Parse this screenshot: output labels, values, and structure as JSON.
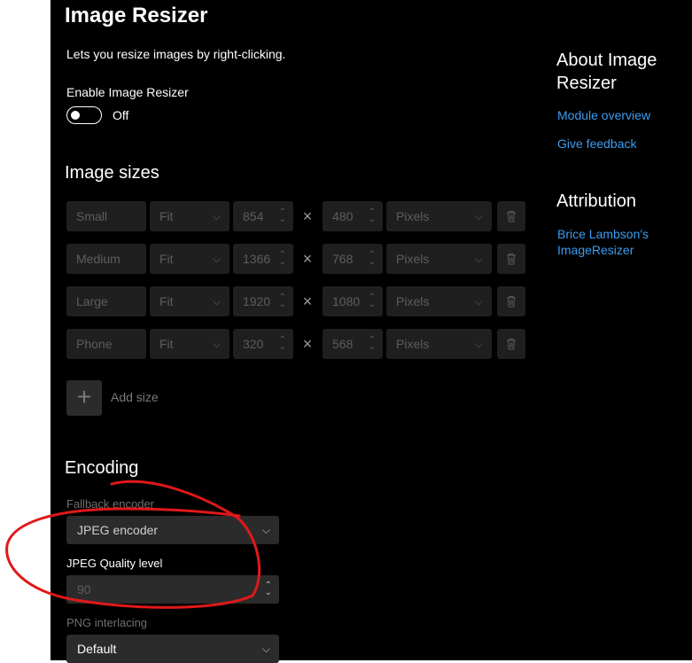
{
  "page": {
    "title": "Image Resizer",
    "description": "Lets you resize images by right-clicking.",
    "enable_label": "Enable Image Resizer",
    "enable_state": "Off"
  },
  "image_sizes": {
    "heading": "Image sizes",
    "rows": [
      {
        "name": "Small",
        "fit": "Fit",
        "width": "854",
        "height": "480",
        "unit": "Pixels"
      },
      {
        "name": "Medium",
        "fit": "Fit",
        "width": "1366",
        "height": "768",
        "unit": "Pixels"
      },
      {
        "name": "Large",
        "fit": "Fit",
        "width": "1920",
        "height": "1080",
        "unit": "Pixels"
      },
      {
        "name": "Phone",
        "fit": "Fit",
        "width": "320",
        "height": "568",
        "unit": "Pixels"
      }
    ],
    "times_symbol": "×",
    "add_label": "Add size"
  },
  "encoding": {
    "heading": "Encoding",
    "fallback_label": "Fallback encoder",
    "fallback_value": "JPEG encoder",
    "quality_label": "JPEG Quality level",
    "quality_value": "90",
    "png_label": "PNG interlacing",
    "png_value": "Default"
  },
  "sidebar": {
    "about_heading": "About Image Resizer",
    "links": [
      "Module overview",
      "Give feedback"
    ],
    "attribution_heading": "Attribution",
    "attribution_link": "Brice Lambson's ImageResizer"
  },
  "colors": {
    "background": "#000000",
    "field": "#1f1f1f",
    "link": "#3b9cf0",
    "annotation": "#e0181b"
  }
}
